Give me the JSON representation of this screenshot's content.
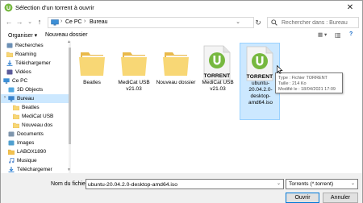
{
  "window": {
    "title": "Sélection d'un torrent à ouvrir",
    "close_glyph": "✕"
  },
  "address": {
    "crumbs": [
      "Ce PC",
      "Bureau"
    ],
    "sep": "›",
    "dropdown": "⌄",
    "refresh_glyph": "↻"
  },
  "nav_glyphs": {
    "back": "←",
    "forward": "→",
    "history": "⌄",
    "up": "↑"
  },
  "search": {
    "placeholder": "Rechercher dans : Bureau"
  },
  "toolbar": {
    "organize": "Organiser ▾",
    "new_folder": "Nouveau dossier",
    "view_glyph": "▦ ▾",
    "pane_glyph": "▥",
    "help_glyph": "?"
  },
  "nav": {
    "items": [
      {
        "label": "Recherches",
        "icon": "search-folder-icon"
      },
      {
        "label": "Roaming",
        "icon": "folder-icon"
      },
      {
        "label": "Téléchargemer",
        "icon": "download-icon"
      },
      {
        "label": "Vidéos",
        "icon": "video-icon"
      },
      {
        "label": "Ce PC",
        "icon": "computer-icon"
      },
      {
        "label": "3D Objects",
        "icon": "3d-objects-icon"
      },
      {
        "label": "Bureau",
        "icon": "desktop-folder-icon"
      },
      {
        "label": "Beatles",
        "icon": "folder-icon"
      },
      {
        "label": "MediCat USB",
        "icon": "folder-icon"
      },
      {
        "label": "Nouveau dos",
        "icon": "folder-icon"
      },
      {
        "label": "Documents",
        "icon": "documents-icon"
      },
      {
        "label": "Images",
        "icon": "images-icon"
      },
      {
        "label": "LABOX1890",
        "icon": "user-folder-icon"
      },
      {
        "label": "Musique",
        "icon": "music-icon"
      },
      {
        "label": "Téléchargemer",
        "icon": "download-icon"
      }
    ],
    "expander": "›"
  },
  "files": [
    {
      "name": "Beatles",
      "type": "folder"
    },
    {
      "name": "MediCat USB v21.03",
      "type": "folder"
    },
    {
      "name": "Nouveau dossier",
      "type": "folder"
    },
    {
      "name": "MediCat USB v21.03",
      "type": "torrent",
      "label": "TORRENT"
    },
    {
      "name": "ubuntu-20.04.2.0-desktop-amd64.iso",
      "type": "torrent",
      "label": "TORRENT"
    }
  ],
  "tooltip": {
    "lines": [
      "Type : Fichier TORRENT",
      "Taille : 214 Ko",
      "Modifié le : 18/04/2021 17:09"
    ]
  },
  "bottom": {
    "filename_label": "Nom du fichier :",
    "filename_value": "ubuntu-20.04.2.0-desktop-amd64.iso",
    "filetype_value": "Torrents (*.torrent)",
    "dropdown": "⌄",
    "open_label": "Ouvrir",
    "cancel_label": "Annuler"
  },
  "scroll_glyphs": {
    "up": "▲",
    "down": "▼"
  },
  "colors": {
    "selection": "#cce8ff",
    "selection_border": "#99d1ff",
    "folder": "#f8d775",
    "utorrent_green": "#76b83f",
    "accent": "#0078d7"
  }
}
